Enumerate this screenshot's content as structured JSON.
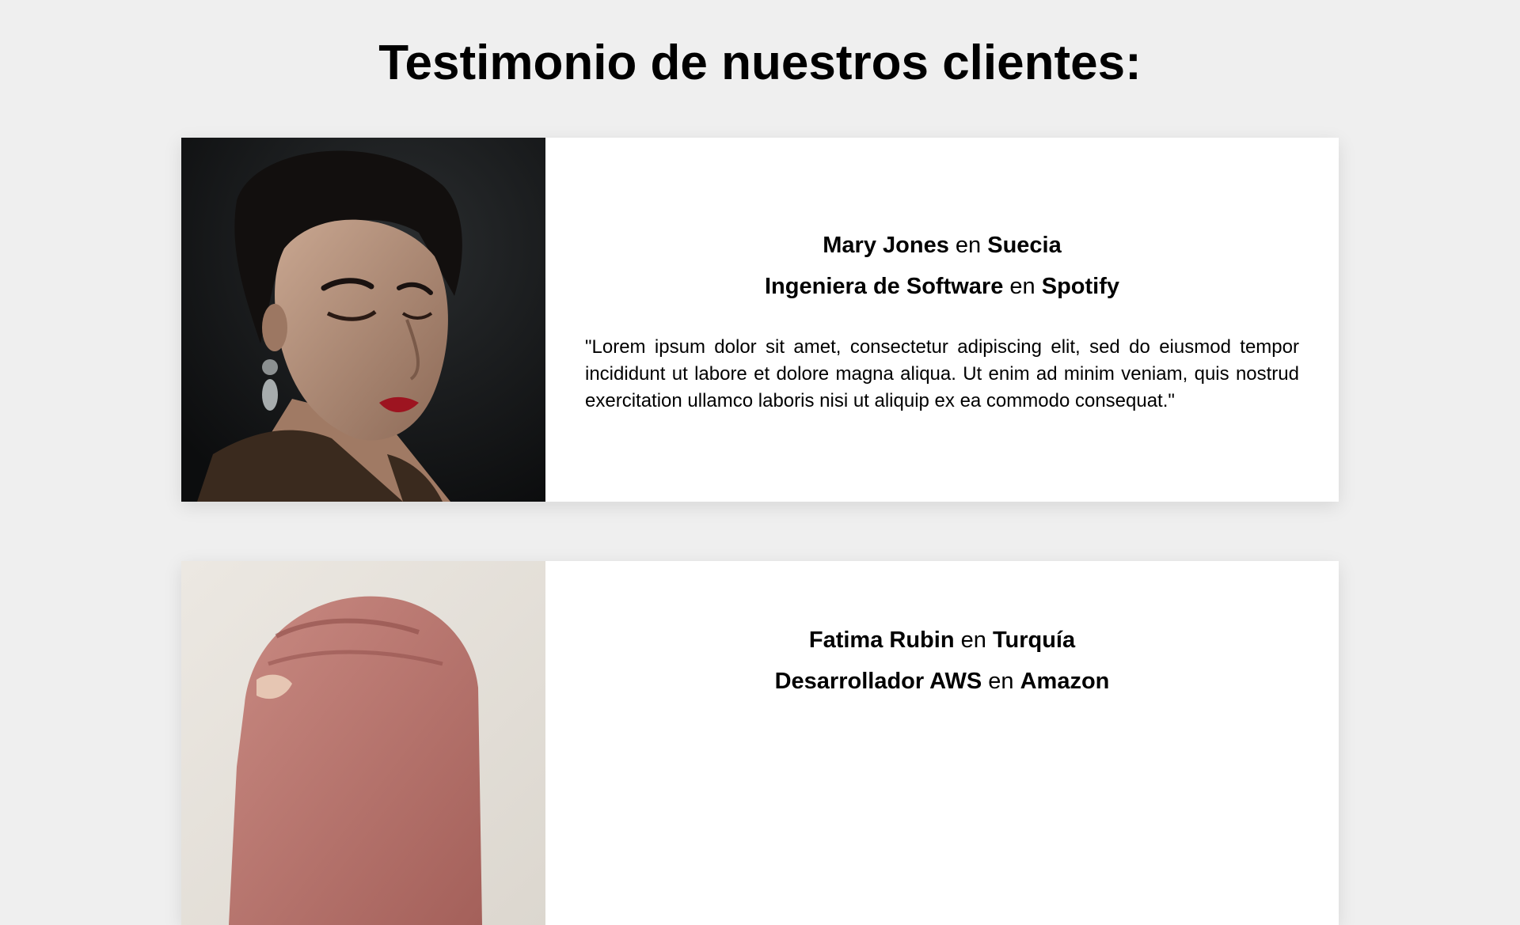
{
  "page": {
    "title": "Testimonio de nuestros clientes:"
  },
  "testimonials": [
    {
      "name": "Mary Jones",
      "connector_location": "en",
      "location": "Suecia",
      "role": "Ingeniera de Software",
      "connector_company": "en",
      "company": "Spotify",
      "quote": "\"Lorem ipsum dolor sit amet, consectetur adipiscing elit, sed do eiusmod tempor incididunt ut labore et dolore magna aliqua. Ut enim ad minim veniam, quis nostrud exercitation ullamco laboris nisi ut aliquip ex ea commodo consequat.\""
    },
    {
      "name": "Fatima Rubin",
      "connector_location": "en",
      "location": "Turquía",
      "role": "Desarrollador AWS",
      "connector_company": "en",
      "company": "Amazon"
    }
  ]
}
